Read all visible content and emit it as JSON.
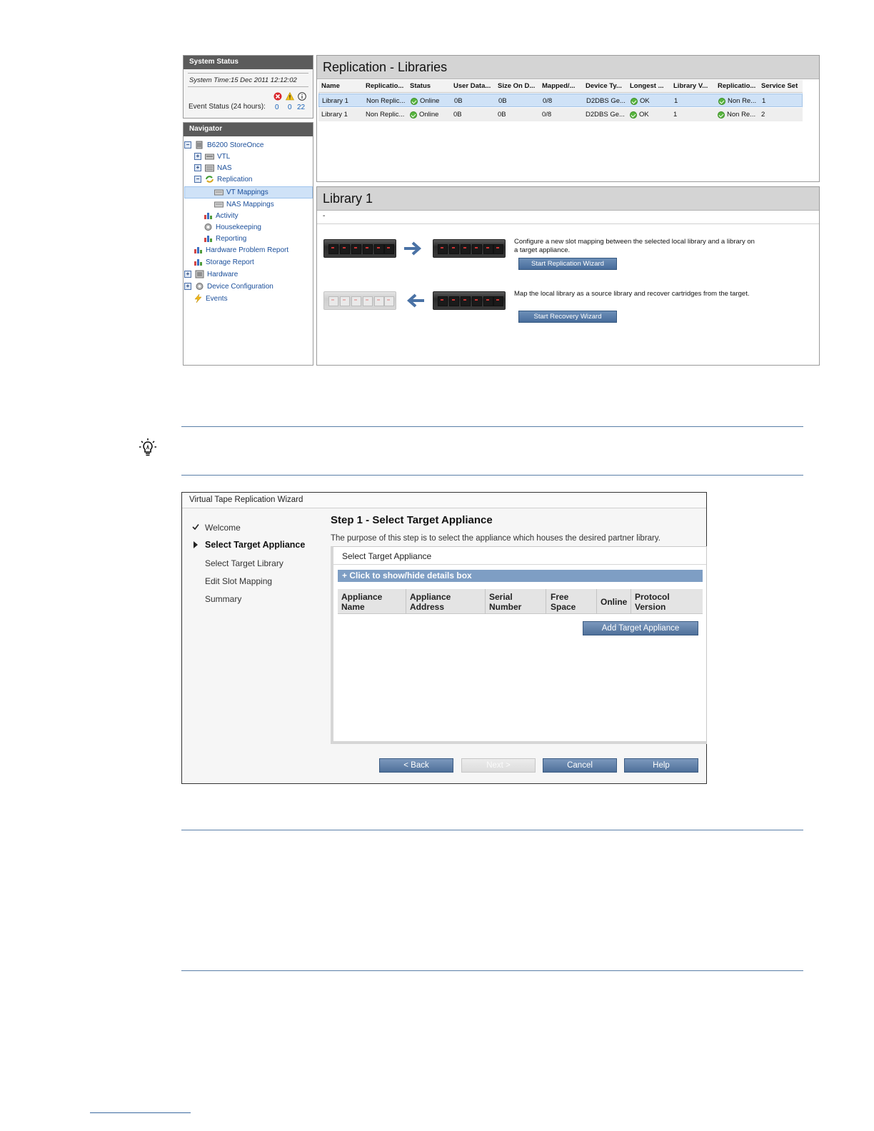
{
  "system_status": {
    "title": "System Status",
    "system_time": "System Time:15 Dec 2011 12:12:02",
    "event_label": "Event Status (24 hours):",
    "errors": "0",
    "warnings": "0",
    "info": "22"
  },
  "navigator": {
    "title": "Navigator",
    "items": [
      {
        "label": "B6200 StoreOnce",
        "icon": "storage-icon",
        "expander": "−"
      },
      {
        "label": "VTL",
        "icon": "tape-icon",
        "expander": "+"
      },
      {
        "label": "NAS",
        "icon": "nas-icon",
        "expander": "+"
      },
      {
        "label": "Replication",
        "icon": "replication-icon",
        "expander": "−"
      },
      {
        "label": "VT Mappings",
        "icon": "mapping-icon"
      },
      {
        "label": "NAS Mappings",
        "icon": "mapping-icon"
      },
      {
        "label": "Activity",
        "icon": "chart-icon"
      },
      {
        "label": "Housekeeping",
        "icon": "gear-icon"
      },
      {
        "label": "Reporting",
        "icon": "chart-icon"
      },
      {
        "label": "Hardware Problem Report",
        "icon": "chart-icon"
      },
      {
        "label": "Storage Report",
        "icon": "chart-icon"
      },
      {
        "label": "Hardware",
        "icon": "hardware-icon",
        "expander": "+"
      },
      {
        "label": "Device Configuration",
        "icon": "gear-icon",
        "expander": "+"
      },
      {
        "label": "Events",
        "icon": "lightning-icon"
      }
    ]
  },
  "replication_libraries": {
    "title": "Replication - Libraries",
    "columns": [
      "Name",
      "Replicatio...",
      "Status",
      "User Data...",
      "Size On D...",
      "Mapped/...",
      "Device Ty...",
      "Longest ...",
      "Library V...",
      "Replicatio...",
      "Service Set"
    ],
    "rows": [
      [
        "Library 1",
        "Non Replic...",
        "Online",
        "0B",
        "0B",
        "0/8",
        "D2DBS Ge...",
        "OK",
        "1",
        "Non Re...",
        "1"
      ],
      [
        "Library 1",
        "Non Replic...",
        "Online",
        "0B",
        "0B",
        "0/8",
        "D2DBS Ge...",
        "OK",
        "1",
        "Non Re...",
        "2"
      ]
    ]
  },
  "library_panel": {
    "title": "Library 1",
    "subtitle": "-",
    "replication_text": "Configure a new slot mapping between the selected local library and a library on a target appliance.",
    "replication_button": "Start Replication Wizard",
    "recovery_text": "Map the local library as a source library and recover cartridges from the target.",
    "recovery_button": "Start Recovery Wizard"
  },
  "wizard": {
    "title": "Virtual Tape Replication Wizard",
    "steps": [
      "Welcome",
      "Select Target Appliance",
      "Select Target Library",
      "Edit Slot Mapping",
      "Summary"
    ],
    "heading": "Step 1 - Select Target Appliance",
    "purpose": "The purpose of this step is to select the appliance which houses the desired partner library.",
    "box_title": "Select Target Appliance",
    "details_toggle": "+ Click to show/hide details box",
    "columns": [
      {
        "l1": "Appliance",
        "l2": "Name"
      },
      {
        "l1": "Appliance",
        "l2": "Address"
      },
      {
        "l1": "Serial",
        "l2": "Number"
      },
      {
        "l1": "Free",
        "l2": "Space"
      },
      {
        "l1": "Online",
        "l2": ""
      },
      {
        "l1": "Protocol",
        "l2": "Version"
      }
    ],
    "add_button": "Add Target Appliance",
    "back": "< Back",
    "next": "Next >",
    "cancel": "Cancel",
    "help": "Help"
  },
  "colors": {
    "accent_blue": "#486d9b",
    "ok_green": "#58b63e",
    "error_red": "#d9262c",
    "warning_yellow": "#f2c21a",
    "link_blue": "#1a4e9a"
  }
}
